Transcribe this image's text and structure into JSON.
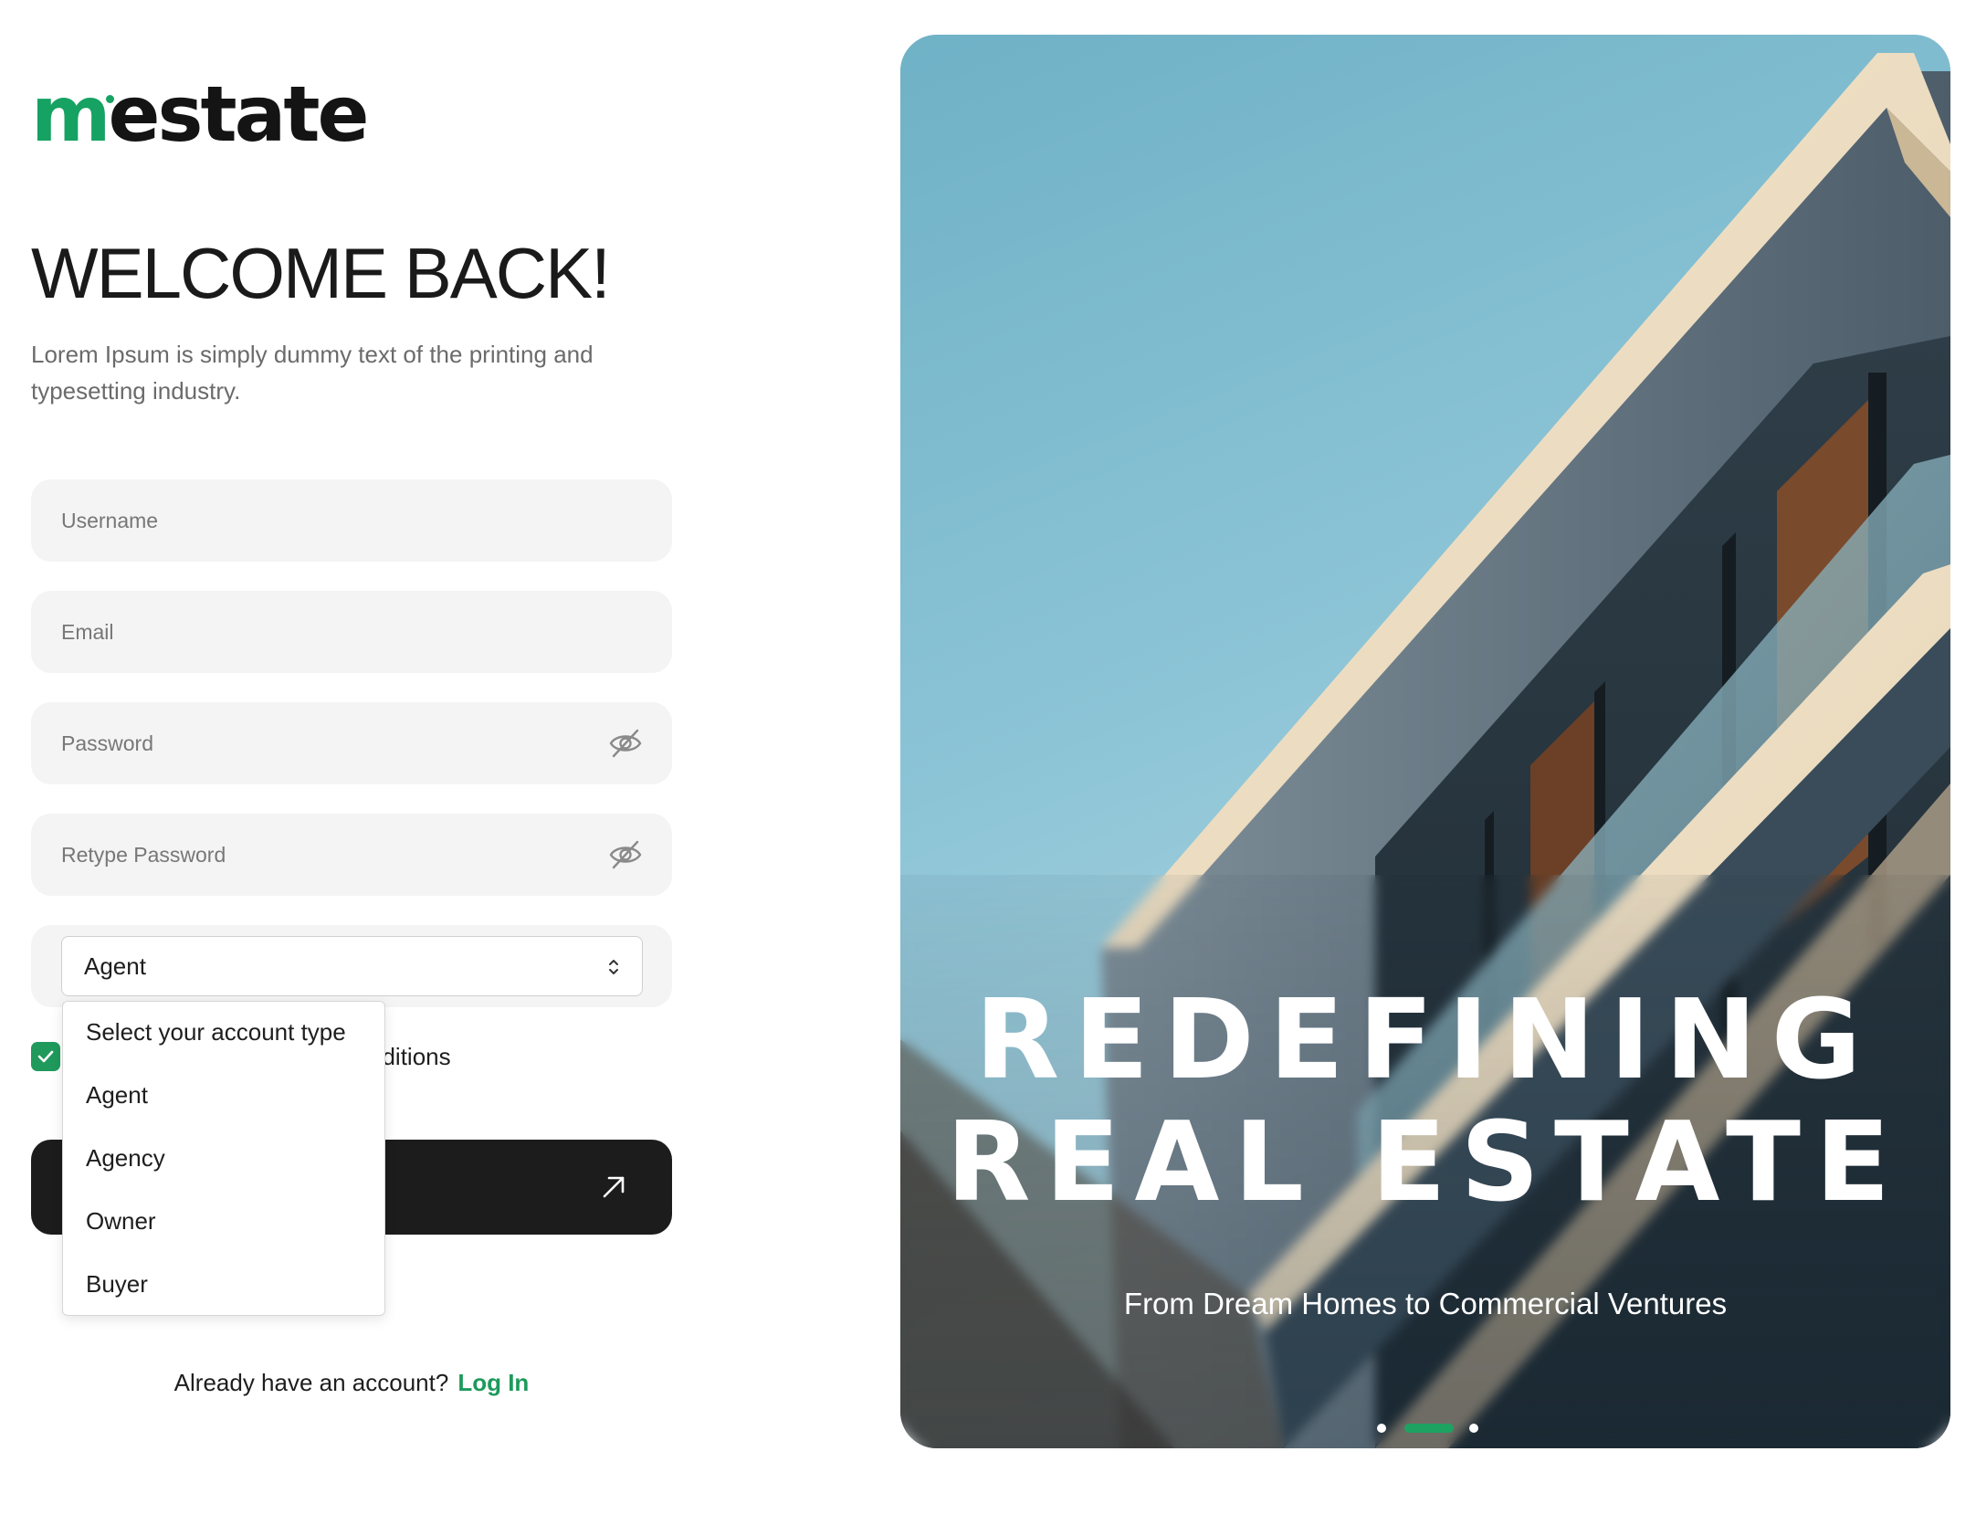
{
  "brand": {
    "logo_m": "m",
    "logo_rest": "estate",
    "accent_color": "#16a262"
  },
  "welcome": {
    "title": "WELCOME BACK!",
    "subtitle": "Lorem Ipsum is simply dummy text of the printing and typesetting industry."
  },
  "form": {
    "username_placeholder": "Username",
    "email_placeholder": "Email",
    "password_placeholder": "Password",
    "retype_password_placeholder": "Retype Password",
    "password_toggle_icon": "eye-off-icon",
    "account_type_value": "Agent",
    "terms_visible_text": "nditions",
    "terms_checked": true,
    "submit_arrow_icon": "arrow-up-right-icon"
  },
  "account_type_dropdown": {
    "options": [
      "Select your account type",
      "Agent",
      "Agency",
      "Owner",
      "Buyer"
    ]
  },
  "footer": {
    "prompt": "Already have an account?",
    "login_link": "Log In"
  },
  "hero": {
    "title_line1": "REDEFINING",
    "title_line2": "REAL ESTATE",
    "subtitle": "From Dream Homes to Commercial Ventures",
    "carousel_slide_count": 3,
    "carousel_active_index": 1
  }
}
